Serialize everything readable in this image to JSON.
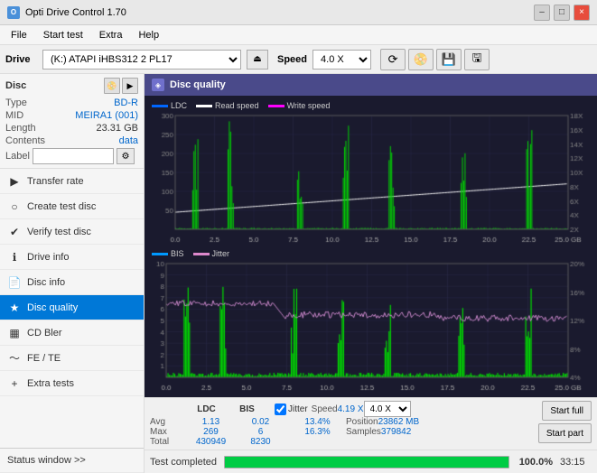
{
  "app": {
    "title": "Opti Drive Control 1.70",
    "icon_label": "O"
  },
  "titlebar": {
    "minimize_label": "–",
    "maximize_label": "□",
    "close_label": "×"
  },
  "menubar": {
    "items": [
      "File",
      "Start test",
      "Extra",
      "Help"
    ]
  },
  "drivebar": {
    "drive_label": "Drive",
    "drive_value": "(K:)  ATAPI iHBS312  2 PL17",
    "speed_label": "Speed",
    "speed_value": "4.0 X"
  },
  "disc": {
    "title": "Disc",
    "type_label": "Type",
    "type_value": "BD-R",
    "mid_label": "MID",
    "mid_value": "MEIRA1 (001)",
    "length_label": "Length",
    "length_value": "23.31 GB",
    "contents_label": "Contents",
    "contents_value": "data",
    "label_label": "Label",
    "label_value": ""
  },
  "nav": {
    "items": [
      {
        "id": "transfer-rate",
        "label": "Transfer rate",
        "icon": "▶"
      },
      {
        "id": "create-test-disc",
        "label": "Create test disc",
        "icon": "💿"
      },
      {
        "id": "verify-test-disc",
        "label": "Verify test disc",
        "icon": "✔"
      },
      {
        "id": "drive-info",
        "label": "Drive info",
        "icon": "ℹ"
      },
      {
        "id": "disc-info",
        "label": "Disc info",
        "icon": "📄"
      },
      {
        "id": "disc-quality",
        "label": "Disc quality",
        "icon": "★",
        "active": true
      },
      {
        "id": "cd-bler",
        "label": "CD Bler",
        "icon": "📊"
      },
      {
        "id": "fe-te",
        "label": "FE / TE",
        "icon": "〜"
      },
      {
        "id": "extra-tests",
        "label": "Extra tests",
        "icon": "+"
      }
    ]
  },
  "chart": {
    "title": "Disc quality",
    "legend": {
      "ldc_label": "LDC",
      "ldc_color": "#0066ff",
      "read_label": "Read speed",
      "read_color": "#ffffff",
      "write_label": "Write speed",
      "write_color": "#ff00ff"
    },
    "legend2": {
      "bis_label": "BIS",
      "bis_color": "#0099ff",
      "jitter_label": "Jitter",
      "jitter_color": "#dd88cc"
    },
    "x_labels": [
      "0.0",
      "2.5",
      "5.0",
      "7.5",
      "10.0",
      "12.5",
      "15.0",
      "17.5",
      "20.0",
      "22.5",
      "25.0 GB"
    ],
    "y_left_top": [
      "300",
      "200",
      "100",
      "50"
    ],
    "y_right_top": [
      "18X",
      "16X",
      "14X",
      "12X",
      "10X",
      "8X",
      "6X",
      "4X",
      "2X"
    ],
    "y_left_bot": [
      "10",
      "9",
      "8",
      "7",
      "6",
      "5",
      "4",
      "3",
      "2",
      "1"
    ],
    "y_right_bot": [
      "20%",
      "16%",
      "12%",
      "8%",
      "4%"
    ]
  },
  "stats": {
    "ldc_header": "LDC",
    "bis_header": "BIS",
    "jitter_header": "Jitter",
    "speed_label": "Speed",
    "speed_value": "4.19 X",
    "speed_select": "4.0 X",
    "position_label": "Position",
    "position_value": "23862 MB",
    "samples_label": "Samples",
    "samples_value": "379842",
    "avg_label": "Avg",
    "avg_ldc": "1.13",
    "avg_bis": "0.02",
    "avg_jitter": "13.4%",
    "max_label": "Max",
    "max_ldc": "269",
    "max_bis": "6",
    "max_jitter": "16.3%",
    "total_label": "Total",
    "total_ldc": "430949",
    "total_bis": "8230",
    "start_full_label": "Start full",
    "start_part_label": "Start part"
  },
  "statusbar": {
    "status_text": "Test completed",
    "progress_pct": 100,
    "progress_label": "100.0%",
    "time_label": "33:15",
    "status_window_label": "Status window >>"
  }
}
